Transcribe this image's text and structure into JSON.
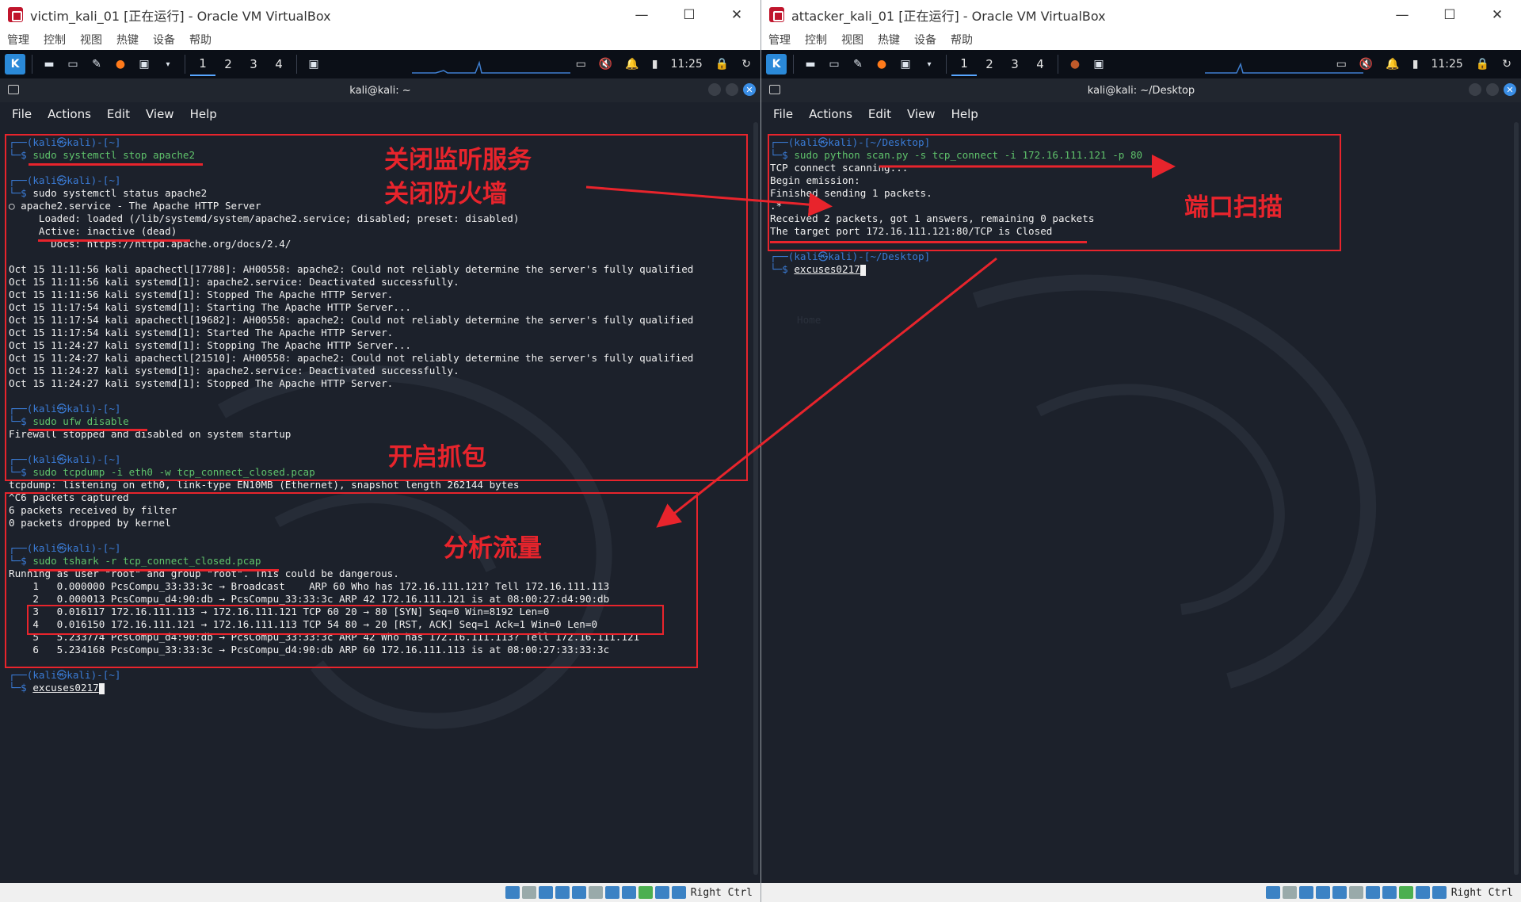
{
  "left_window": {
    "title": "victim_kali_01 [正在运行] - Oracle VM VirtualBox",
    "menu": [
      "管理",
      "控制",
      "视图",
      "热键",
      "设备",
      "帮助"
    ],
    "workspaces": [
      "1",
      "2",
      "3",
      "4"
    ],
    "clock": "11:25",
    "terminal_title": "kali@kali: ~",
    "terminal_menu": [
      "File",
      "Actions",
      "Edit",
      "View",
      "Help"
    ],
    "status_text": "Right Ctrl"
  },
  "right_window": {
    "title": "attacker_kali_01 [正在运行] - Oracle VM VirtualBox",
    "menu": [
      "管理",
      "控制",
      "视图",
      "热键",
      "设备",
      "帮助"
    ],
    "workspaces": [
      "1",
      "2",
      "3",
      "4"
    ],
    "clock": "11:25",
    "terminal_title": "kali@kali: ~/Desktop",
    "terminal_menu": [
      "File",
      "Actions",
      "Edit",
      "View",
      "Help"
    ],
    "status_text": "Right Ctrl"
  },
  "left_terminal": {
    "prompt_top": "┌──(kali㉿kali)-[~]",
    "prompt_bottom": "└─$",
    "cmd1": "sudo systemctl stop apache2",
    "cmd2": "sudo systemctl status apache2",
    "service_line": "○ apache2.service - The Apache HTTP Server",
    "loaded_line": "     Loaded: loaded (/lib/systemd/system/apache2.service; disabled; preset: disabled)",
    "active_line": "     Active: inactive (dead)",
    "docs_line": "       Docs: https://httpd.apache.org/docs/2.4/",
    "log_lines": [
      "Oct 15 11:11:56 kali apachectl[17788]: AH00558: apache2: Could not reliably determine the server's fully qualified",
      "Oct 15 11:11:56 kali systemd[1]: apache2.service: Deactivated successfully.",
      "Oct 15 11:11:56 kali systemd[1]: Stopped The Apache HTTP Server.",
      "Oct 15 11:17:54 kali systemd[1]: Starting The Apache HTTP Server...",
      "Oct 15 11:17:54 kali apachectl[19682]: AH00558: apache2: Could not reliably determine the server's fully qualified",
      "Oct 15 11:17:54 kali systemd[1]: Started The Apache HTTP Server.",
      "Oct 15 11:24:27 kali systemd[1]: Stopping The Apache HTTP Server...",
      "Oct 15 11:24:27 kali apachectl[21510]: AH00558: apache2: Could not reliably determine the server's fully qualified",
      "Oct 15 11:24:27 kali systemd[1]: apache2.service: Deactivated successfully.",
      "Oct 15 11:24:27 kali systemd[1]: Stopped The Apache HTTP Server."
    ],
    "cmd3": "sudo ufw disable",
    "ufw_out": "Firewall stopped and disabled on system startup",
    "cmd4": "sudo tcpdump -i eth0 -w tcp_connect_closed.pcap",
    "tcpdump_out": [
      "tcpdump: listening on eth0, link-type EN10MB (Ethernet), snapshot length 262144 bytes",
      "^C6 packets captured",
      "6 packets received by filter",
      "0 packets dropped by kernel"
    ],
    "cmd5": "sudo tshark -r tcp_connect_closed.pcap",
    "tshark_warn": "Running as user \"root\" and group \"root\". This could be dangerous.",
    "packets": [
      "    1   0.000000 PcsCompu_33:33:3c → Broadcast    ARP 60 Who has 172.16.111.121? Tell 172.16.111.113",
      "    2   0.000013 PcsCompu_d4:90:db → PcsCompu_33:33:3c ARP 42 172.16.111.121 is at 08:00:27:d4:90:db",
      "    3   0.016117 172.16.111.113 → 172.16.111.121 TCP 60 20 → 80 [SYN] Seq=0 Win=8192 Len=0",
      "    4   0.016150 172.16.111.121 → 172.16.111.113 TCP 54 80 → 20 [RST, ACK] Seq=1 Ack=1 Win=0 Len=0",
      "    5   5.233774 PcsCompu_d4:90:db → PcsCompu_33:33:3c ARP 42 Who has 172.16.111.113? Tell 172.16.111.121",
      "    6   5.234168 PcsCompu_33:33:3c → PcsCompu_d4:90:db ARP 60 172.16.111.113 is at 08:00:27:33:33:3c"
    ],
    "typed": "excuses0217"
  },
  "right_terminal": {
    "prompt_top": "┌──(kali㉿kali)-[~/Desktop]",
    "prompt_bottom": "└─$",
    "cmd1": "sudo python scan.py -s tcp_connect -i 172.16.111.121 -p 80",
    "output": [
      "TCP connect scanning...",
      "Begin emission:",
      "Finished sending 1 packets.",
      ".*",
      "Received 2 packets, got 1 answers, remaining 0 packets",
      "The target port 172.16.111.121:80/TCP is Closed"
    ],
    "typed": "excuses0217",
    "faint_text": "Home"
  },
  "annotations": {
    "stop_service": "关闭监听服务",
    "disable_firewall": "关闭防火墙",
    "start_capture": "开启抓包",
    "analyze_traffic": "分析流量",
    "port_scan": "端口扫描"
  },
  "colors": {
    "annotation_red": "#e8242c",
    "prompt_blue": "#3a7bd5",
    "command_green": "#5fc26b",
    "terminal_bg": "#1c212b"
  }
}
